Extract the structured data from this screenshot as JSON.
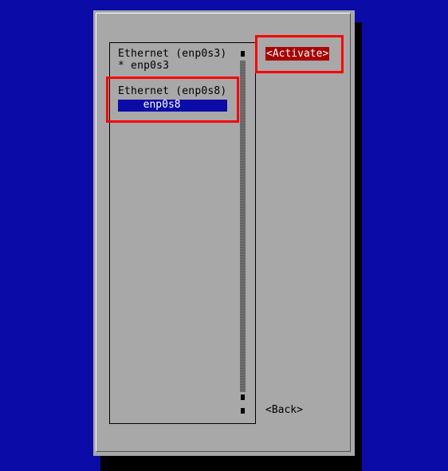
{
  "connections": [
    {
      "type_label": "Ethernet (enp0s3)",
      "device": "* enp0s3",
      "selected": false
    },
    {
      "type_label": "Ethernet (enp0s8)",
      "device": "  enp0s8",
      "selected": true
    }
  ],
  "buttons": {
    "activate": "<Activate>",
    "back": "<Back>"
  },
  "colors": {
    "background": "#0b0ba8",
    "dialog": "#a8a8a8",
    "selection": "#0b0ba8",
    "focused_button": "#a80000",
    "annotation": "#ff0000"
  }
}
